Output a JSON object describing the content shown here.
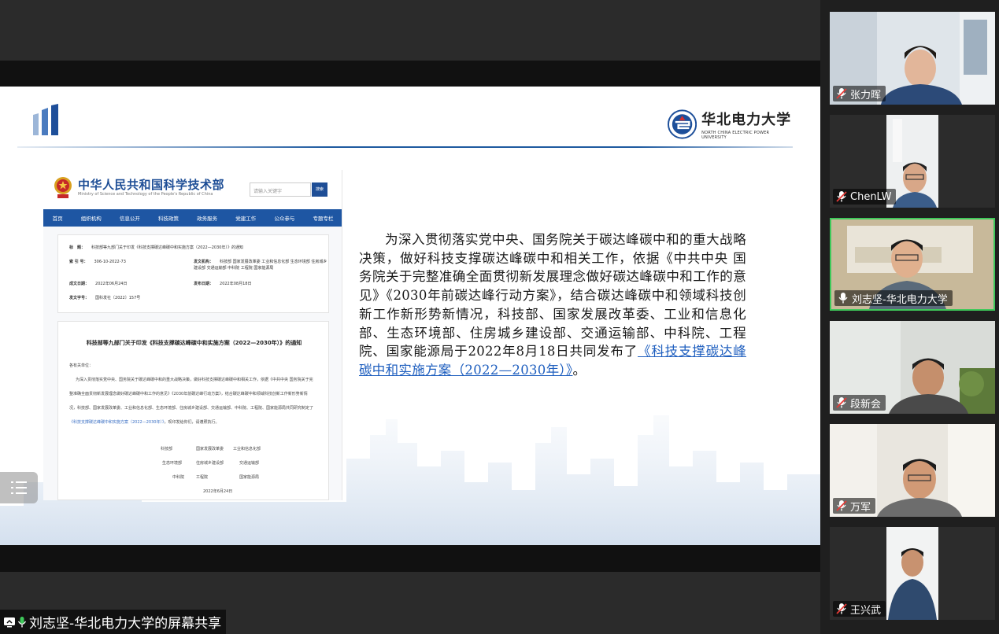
{
  "slide": {
    "university_cn": "华北电力大学",
    "university_en": "NORTH CHINA ELECTRIC POWER UNIVERSITY",
    "paragraph_main": "为深入贯彻落实党中央、国务院关于碳达峰碳中和的重大战略决策，做好科技支撑碳达峰碳中和相关工作，依据《中共中央 国务院关于完整准确全面贯彻新发展理念做好碳达峰碳中和工作的意见》《2030年前碳达峰行动方案》，结合碳达峰碳中和领域科技创新工作新形势新情况，科技部、国家发展改革委、工业和信息化部、生态环境部、住房城乡建设部、交通运输部、中科院、工程院、国家能源局于2022年8月18日共同发布了",
    "paragraph_link": "《科技支撑碳达峰碳中和实施方案（2022—2030年）》",
    "paragraph_end": "。"
  },
  "ministry_page": {
    "title": "中华人民共和国科学技术部",
    "subtitle": "Ministry of Science and Technology of the People's Republic of China",
    "search_placeholder": "请输入关键字",
    "search_button": "搜索",
    "nav": [
      "首页",
      "组织机构",
      "信息公开",
      "科技政策",
      "政务服务",
      "党建工作",
      "公众参与",
      "专题专栏"
    ],
    "info": {
      "label_title": "标　题：",
      "value_title": "科技部等九部门关于印发《科技支撑碳达峰碳中和实施方案（2022—2030年）》的通知",
      "label_index": "索 引 号：",
      "value_index": "306-10-2022-73",
      "label_issuer": "发文机构：",
      "value_issuer": "科技部 国家发展改革委 工业和信息化部 生态环境部 住房城乡建设部 交通运输部 中科院 工程院 国家能源局",
      "label_date": "成文日期：",
      "value_date": "2022年06月24日",
      "label_pub": "发布日期：",
      "value_pub": "2022年08月18日",
      "label_num": "发文字号：",
      "value_num": "国科发社〔2022〕157号"
    },
    "doc": {
      "title": "科技部等九部门关于印发《科技支撑碳达峰碳中和实施方案（2022—2030年）》的通知",
      "greeting": "各有关单位：",
      "line1": "为深入贯彻落实党中央、国务院关于碳达峰碳中和的重大战略决策，做好科技支撑碳达峰碳中和相关工作，依据《中共中央 国务院关于完",
      "line2": "整准确全面贯彻新发展理念做好碳达峰碳中和工作的意见》《2030年前碳达峰行动方案》，结合碳达峰碳中和领域科技创新工作新形势新情",
      "line3": "况，科技部、国家发展改革委、工业和信息化部、生态环境部、住房城乡建设部、交通运输部、中科院、工程院、国家能源局共同研究制定了",
      "line4_link": "《科技支撑碳达峰碳中和实施方案（2022—2030年）》",
      "line4_rest": "，现印发给你们，请遵照执行。",
      "signers": [
        [
          "科技部",
          "国家发展改革委",
          "工业和信息化部"
        ],
        [
          "生态环境部",
          "住房城乡建设部",
          "交通运输部"
        ],
        [
          "中科院",
          "工程院",
          "国家能源局"
        ]
      ],
      "sign_date": "2022年6月24日"
    }
  },
  "share_label": "刘志坚-华北电力大学的屏幕共享",
  "participants": [
    {
      "name": "张力晖",
      "muted": true
    },
    {
      "name": "ChenLW",
      "muted": true
    },
    {
      "name": "刘志坚-华北电力大学",
      "muted": false
    },
    {
      "name": "段新会",
      "muted": true
    },
    {
      "name": "万军",
      "muted": true
    },
    {
      "name": "王兴武",
      "muted": true
    }
  ],
  "colors": {
    "accent_green": "#3ec95a",
    "ministry_blue": "#1e56a3",
    "link_blue": "#1f5fbf",
    "muted_red": "#e53935"
  }
}
